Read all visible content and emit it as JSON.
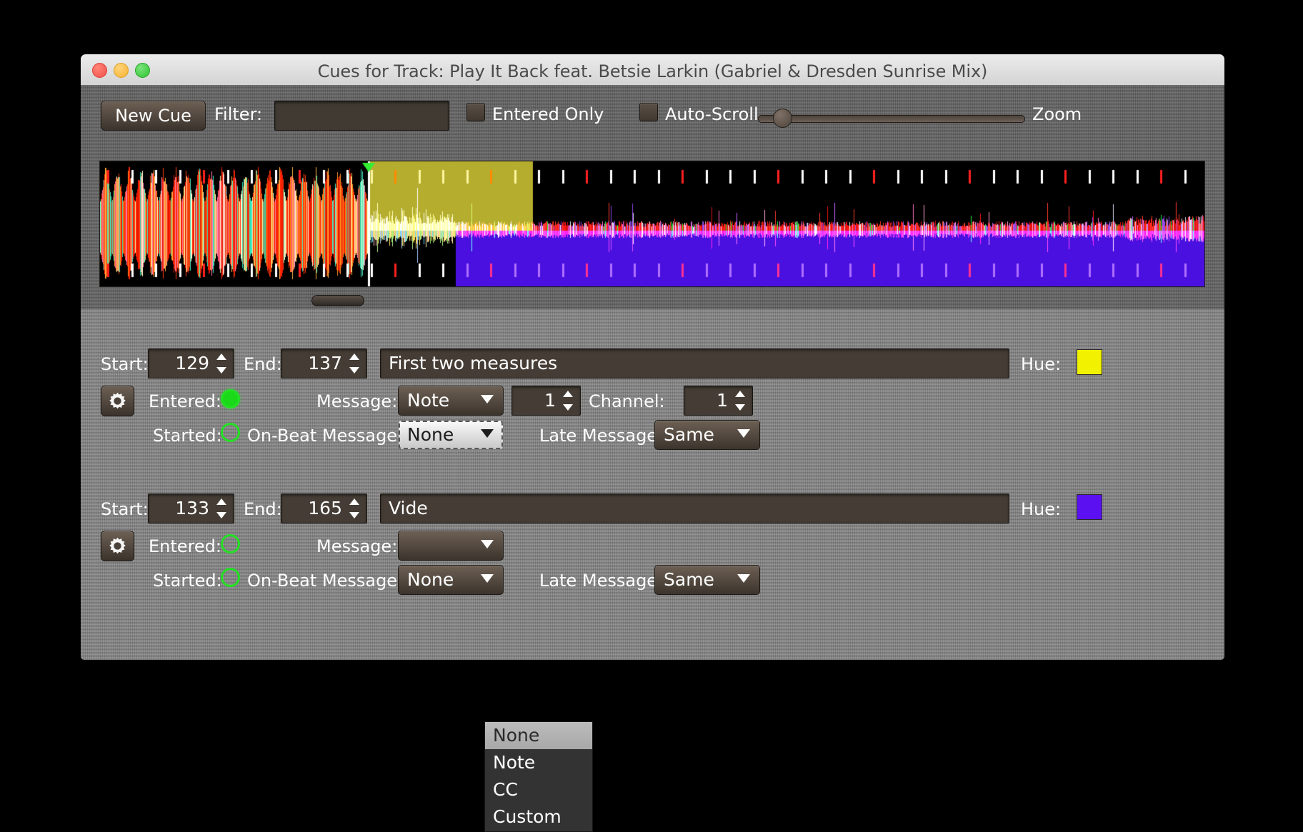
{
  "window": {
    "title": "Cues for Track: Play It Back feat. Betsie Larkin (Gabriel & Dresden Sunrise Mix)",
    "traffic_lights": {
      "close": "close",
      "minimize": "minimize",
      "maximize": "maximize"
    }
  },
  "toolbar": {
    "new_cue_label": "New Cue",
    "filter_label": "Filter:",
    "filter_value": "",
    "filter_placeholder": "",
    "entered_only_label": "Entered Only",
    "entered_only_checked": false,
    "auto_scroll_label": "Auto-Scroll",
    "auto_scroll_checked": false,
    "zoom_label": "Zoom",
    "zoom_slider_percent": 6
  },
  "waveform": {
    "playhead_position_percent": 24.3,
    "cue_overlays": [
      {
        "hue": "#b5ad2e",
        "start_percent": 24.3,
        "end_percent": 39.2,
        "half": "top"
      },
      {
        "hue": "#4a10e0",
        "start_percent": 32.2,
        "end_percent": 100.0,
        "half": "bottom"
      }
    ],
    "scrollbar_thumb_percent": 20
  },
  "cues": [
    {
      "start_label": "Start:",
      "start_value": "129",
      "end_label": "End:",
      "end_value": "137",
      "comment": "First two measures",
      "hue_label": "Hue:",
      "hue_color": "#f2f200",
      "gear_icon": "gear-icon",
      "entered_label": "Entered:",
      "entered_on": true,
      "message_label": "Message:",
      "message_value": "Note",
      "message_number": "1",
      "channel_label": "Channel:",
      "channel_value": "1",
      "started_label": "Started:",
      "started_on": false,
      "onbeat_label": "On-Beat Message:",
      "onbeat_value": "None",
      "onbeat_open": true,
      "late_label": "Late Message:",
      "late_value": "Same"
    },
    {
      "start_label": "Start:",
      "start_value": "133",
      "end_label": "End:",
      "end_value": "165",
      "comment": "Vide",
      "hue_label": "Hue:",
      "hue_color": "#5a10f0",
      "gear_icon": "gear-icon",
      "entered_label": "Entered:",
      "entered_on": false,
      "message_label": "Message:",
      "message_value": "",
      "message_number": "",
      "channel_label": "",
      "channel_value": "",
      "started_label": "Started:",
      "started_on": false,
      "onbeat_label": "On-Beat Message:",
      "onbeat_value": "None",
      "onbeat_open": false,
      "late_label": "Late Message:",
      "late_value": "Same"
    }
  ],
  "dropdown_popup": {
    "options": [
      "None",
      "Note",
      "CC",
      "Custom"
    ],
    "selected": "None"
  }
}
